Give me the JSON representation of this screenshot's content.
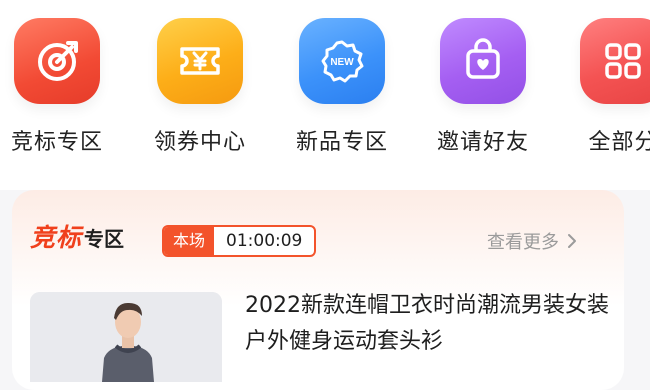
{
  "nav": [
    {
      "label": "竞标专区",
      "icon": "target-icon",
      "color": "#f24a34"
    },
    {
      "label": "领券中心",
      "icon": "coupon-icon",
      "color": "#fdae18"
    },
    {
      "label": "新品专区",
      "icon": "new-badge-icon",
      "color": "#3c92fa"
    },
    {
      "label": "邀请好友",
      "icon": "gift-bag-icon",
      "color": "#a55ff2"
    },
    {
      "label": "全部分",
      "icon": "grid-icon",
      "color": "#f45353"
    }
  ],
  "section": {
    "title_red": "竞标",
    "title_dark": "专区",
    "timer_tag": "本场",
    "timer_value": "01:00:09",
    "more_label": "查看更多"
  },
  "product": {
    "title": "2022新款连帽卫衣时尚潮流男装女装户外健身运动套头衫"
  }
}
